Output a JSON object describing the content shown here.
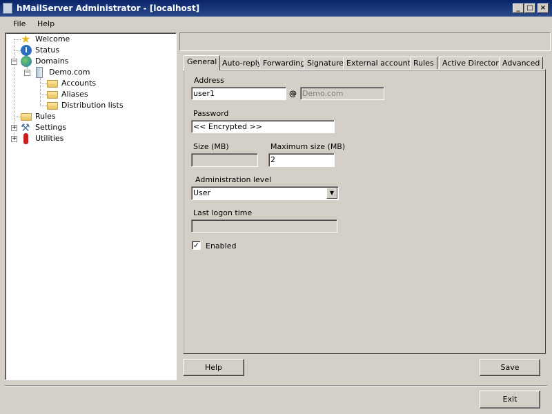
{
  "window": {
    "title": "hMailServer Administrator - [localhost]",
    "minimize": "_",
    "maximize": "□",
    "close": "×"
  },
  "menu": {
    "file": "File",
    "help": "Help"
  },
  "tree": [
    {
      "label": "Welcome",
      "icon": "star-icon"
    },
    {
      "label": "Status",
      "icon": "info-icon"
    },
    {
      "label": "Domains",
      "icon": "globe-icon"
    },
    {
      "label": "Demo.com",
      "icon": "server-icon"
    },
    {
      "label": "Accounts",
      "icon": "folder-icon"
    },
    {
      "label": "Aliases",
      "icon": "folder-icon"
    },
    {
      "label": "Distribution lists",
      "icon": "folder-icon"
    },
    {
      "label": "Rules",
      "icon": "folder-icon"
    },
    {
      "label": "Settings",
      "icon": "tools-icon"
    },
    {
      "label": "Utilities",
      "icon": "knife-icon"
    }
  ],
  "tree_expanders": {
    "collapse": "−",
    "expand": "+"
  },
  "tabs": [
    "General",
    "Auto-reply",
    "Forwarding",
    "Signature",
    "External accounts",
    "Rules",
    "Active Directory",
    "Advanced"
  ],
  "form": {
    "address_label": "Address",
    "address_value": "user1",
    "at": "@",
    "domain_value": "Demo.com",
    "password_label": "Password",
    "password_value": "<< Encrypted >>",
    "size_label": "Size (MB)",
    "size_value": "",
    "maxsize_label": "Maximum size (MB)",
    "maxsize_value": "2",
    "admin_label": "Administration level",
    "admin_value": "User",
    "logon_label": "Last logon time",
    "logon_value": "",
    "enabled_label": "Enabled",
    "enabled_checked": true
  },
  "buttons": {
    "help": "Help",
    "save": "Save",
    "exit": "Exit"
  }
}
